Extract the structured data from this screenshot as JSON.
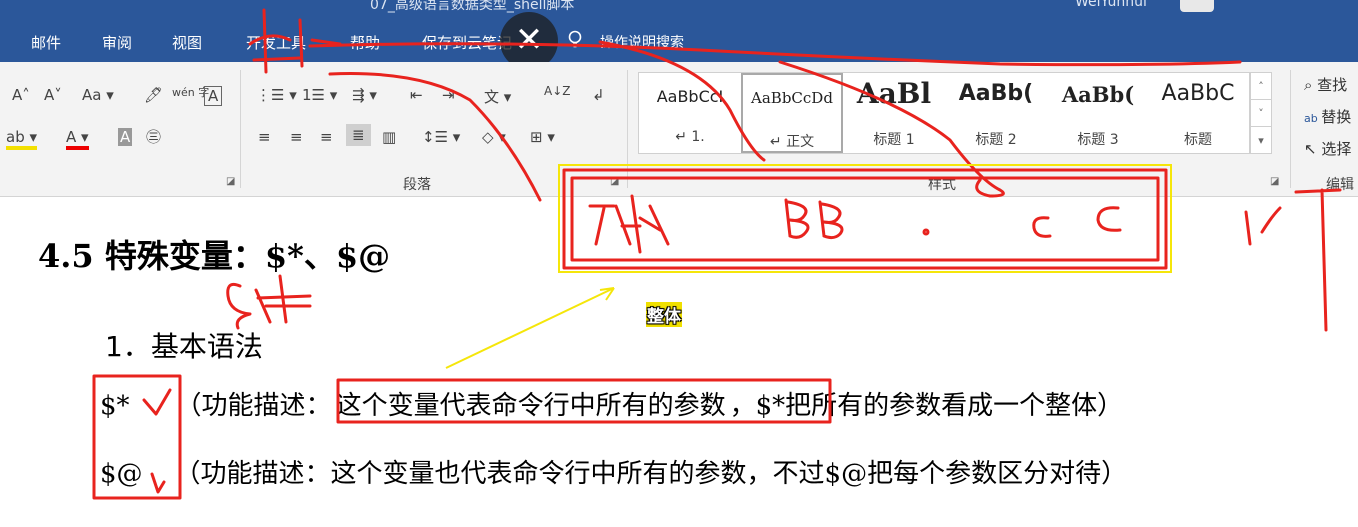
{
  "window": {
    "title": "07_高级语言数据类型_shell脚本",
    "user": "WeiYunhui"
  },
  "menu": {
    "tabs": [
      "邮件",
      "审阅",
      "视图",
      "开发工具",
      "帮助",
      "保存到云笔记",
      "操作说明搜索"
    ],
    "close_glyph": "✕"
  },
  "ribbon": {
    "font": {
      "grow": "A˄",
      "shrink": "A˅",
      "case": "Aa ▾",
      "clear": "🖊",
      "phonetic": "wén 字",
      "border": "A",
      "highlight": "ab ▾",
      "font_color": "A ▾",
      "shading": "A",
      "enclose": "㊂"
    },
    "paragraph": {
      "label": "段落",
      "row1": [
        "⋮☰ ▾",
        "1☰ ▾",
        "⇶ ▾",
        "⇤",
        "⇥",
        "文 ▾",
        "A↓Z",
        "↲"
      ],
      "row2": [
        "≡",
        "≡",
        "≡",
        "≣",
        "▥",
        "↕☰ ▾",
        "◇ ▾",
        "⊞ ▾"
      ]
    },
    "styles": {
      "label": "样式",
      "items": [
        {
          "sample": "AaBbCcI",
          "name": "↵ 1."
        },
        {
          "sample": "AaBbCcDd",
          "name": "↵ 正文"
        },
        {
          "sample": "AaBl",
          "name": "标题 1"
        },
        {
          "sample": "AaBb(",
          "name": "标题 2"
        },
        {
          "sample": "AaBb(",
          "name": "标题 3"
        },
        {
          "sample": "AaBbC",
          "name": "标题"
        }
      ],
      "scroll": [
        "˄",
        "˅",
        "▾"
      ]
    },
    "editing": {
      "find": "查找",
      "replace": "替换",
      "select": "选择",
      "label": "编辑"
    }
  },
  "document": {
    "heading": "4.5  特殊变量：$*、$@",
    "subheading": "1．基本语法",
    "line1": {
      "var": "$*",
      "prefix": "（功能描述：",
      "boxed": "这个变量代表命令行中所有的参数",
      "suffix": "，$*把所有的参数看成一个整体）"
    },
    "line2": {
      "var": "$@",
      "text": "（功能描述：这个变量也代表命令行中所有的参数，不过$@把每个参数区分对待）"
    }
  },
  "annotations": {
    "caption": "整体",
    "colors": {
      "ink": "#e8231e",
      "arrow": "#f5e60a",
      "box_highlight": "#f5e60a"
    }
  }
}
